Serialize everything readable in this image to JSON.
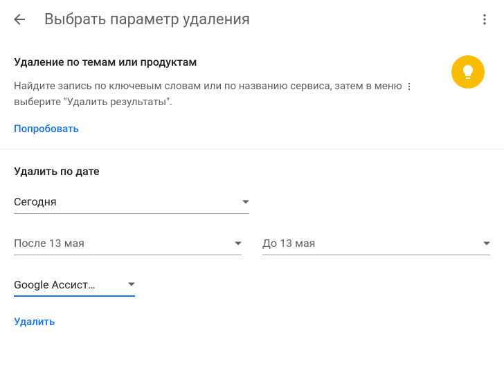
{
  "header": {
    "title": "Выбрать параметр удаления"
  },
  "topic": {
    "title": "Удаление по темам или продуктам",
    "text_before": "Найдите запись по ключевым словам или по названию сервиса, затем в меню ",
    "text_after": " выберите \"Удалить результаты\".",
    "try_label": "Попробовать"
  },
  "date": {
    "title": "Удалить по дате",
    "range": "Сегодня",
    "after": "После 13 мая",
    "before": "До 13 мая",
    "product": "Google Ассист…",
    "delete_label": "Удалить"
  }
}
